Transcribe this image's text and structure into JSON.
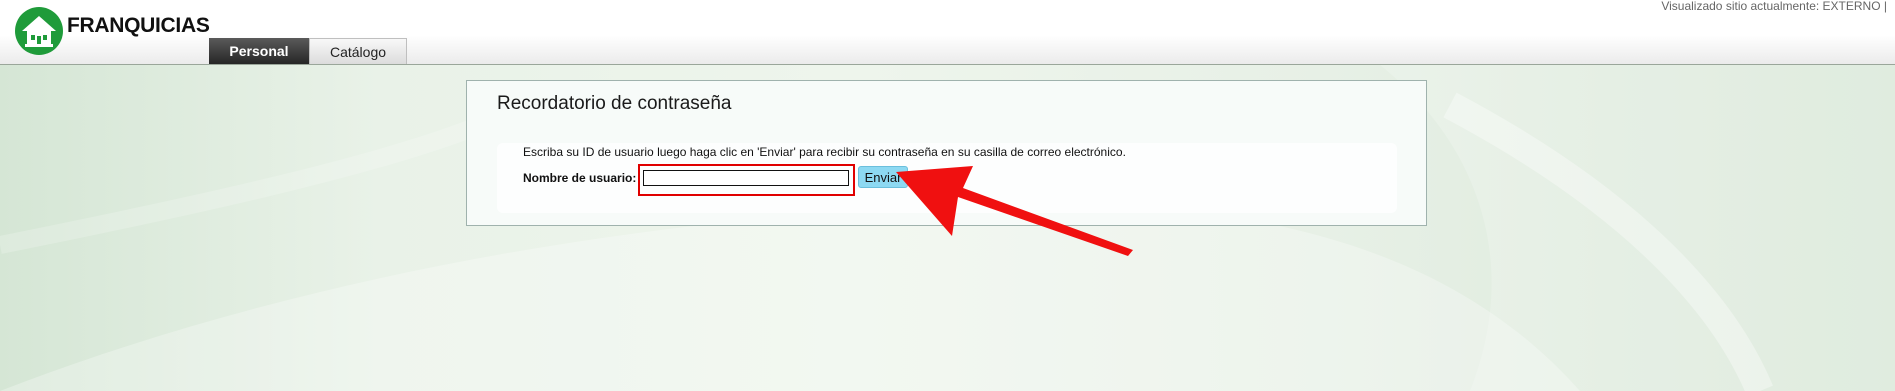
{
  "header": {
    "brand": "FRANQUICIAS",
    "status_text": "Visualizado sitio actualmente: EXTERNO |",
    "tabs": [
      {
        "label": "Personal",
        "active": true
      },
      {
        "label": "Catálogo",
        "active": false
      }
    ]
  },
  "panel": {
    "title": "Recordatorio de contraseña",
    "instructions": "Escriba su ID de usuario luego haga clic en 'Enviar' para recibir su contraseña en su casilla de correo electrónico.",
    "username_label": "Nombre de usuario:",
    "username_value": "",
    "send_label": "Enviar"
  },
  "colors": {
    "brand_green": "#1f9b3a",
    "highlight_red": "#e00000",
    "button_blue": "#8dd9f2",
    "active_tab": "#333333"
  },
  "icons": {
    "logo": "house-logo-icon",
    "annotation": "red-arrow-icon"
  }
}
